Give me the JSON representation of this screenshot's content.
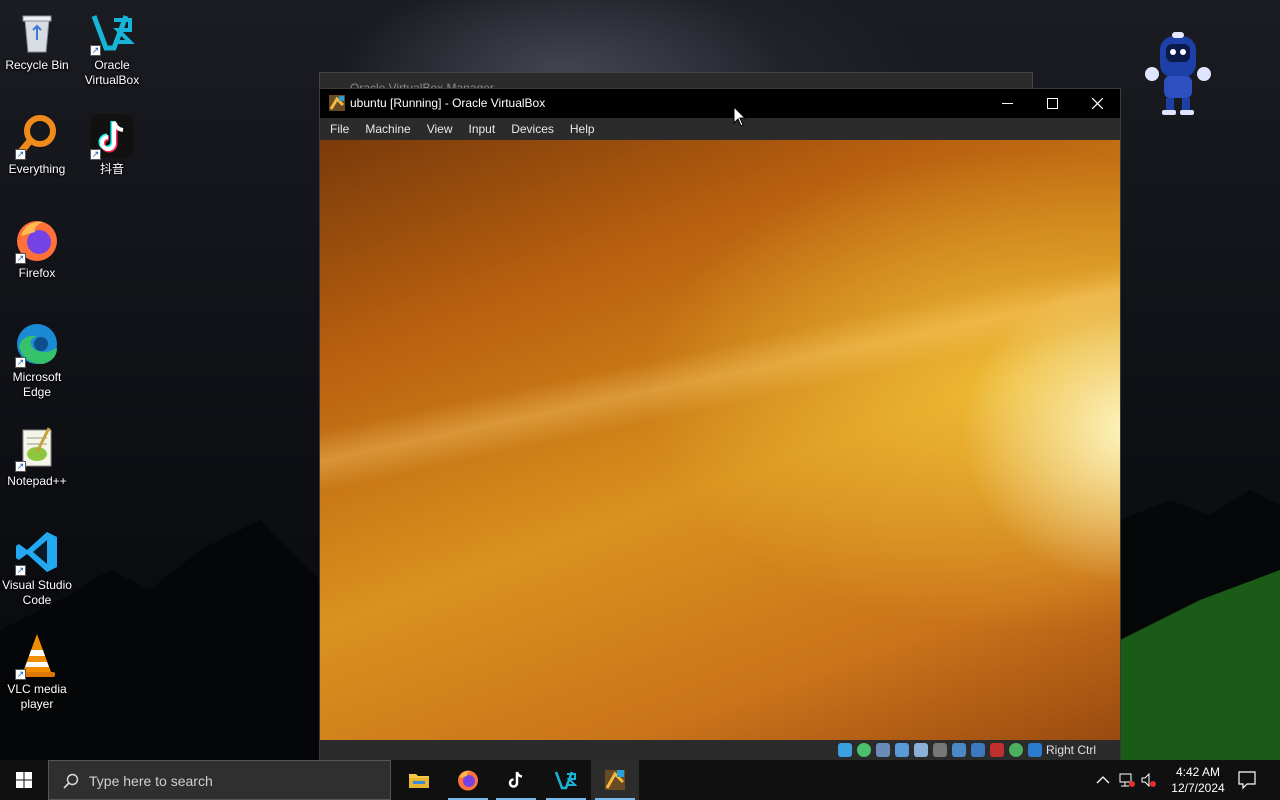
{
  "desktop": {
    "icons": [
      {
        "label": "Recycle Bin"
      },
      {
        "label": "Oracle VirtualBox"
      },
      {
        "label": "Everything"
      },
      {
        "label": "抖音"
      },
      {
        "label": "Firefox"
      },
      {
        "label": "Microsoft Edge"
      },
      {
        "label": "Notepad++"
      },
      {
        "label": "Visual Studio Code"
      },
      {
        "label": "VLC media player"
      }
    ]
  },
  "background_window": {
    "title": "Oracle VirtualBox Manager"
  },
  "window": {
    "title": "ubuntu [Running] - Oracle VirtualBox",
    "menu": [
      "File",
      "Machine",
      "View",
      "Input",
      "Devices",
      "Help"
    ],
    "host_key": "Right Ctrl"
  },
  "taskbar": {
    "search_placeholder": "Type here to search",
    "apps": [
      "file-explorer",
      "firefox",
      "tiktok",
      "virtualbox-manager",
      "virtualbox-vm"
    ],
    "time": "4:42 AM",
    "date": "12/7/2024"
  },
  "colors": {
    "taskbar": "#101010",
    "titlebar": "#000000",
    "accent": "#76b9ed"
  }
}
